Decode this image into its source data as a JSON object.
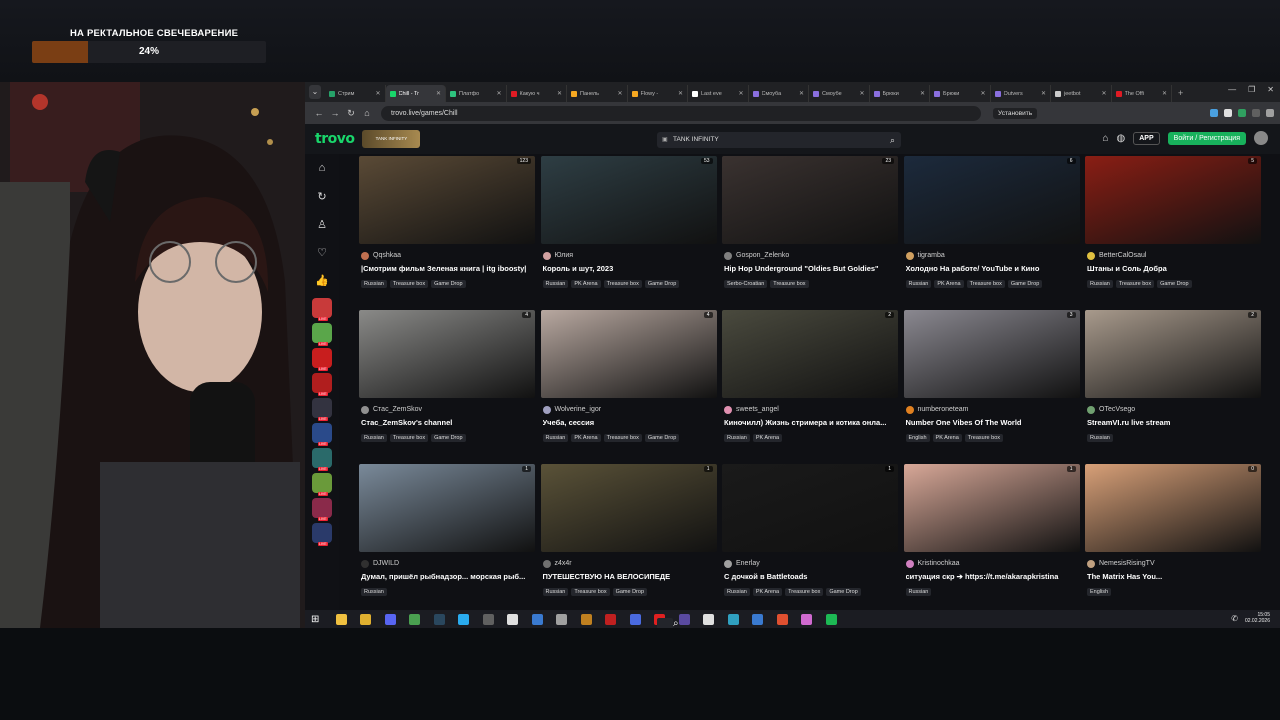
{
  "overlay": {
    "goal_label": "НА РЕКТАЛЬНОЕ СВЕЧЕВАРЕНИЕ",
    "goal_percent_text": "24%",
    "goal_progress": 0.24,
    "goal_color": "#7a3e14"
  },
  "browser": {
    "tabs": [
      {
        "label": "Стрим",
        "color": "#26a269"
      },
      {
        "label": "Chill - Tr",
        "color": "#19d66b",
        "active": true
      },
      {
        "label": "Платфо",
        "color": "#2ec27e"
      },
      {
        "label": "Какую ч",
        "color": "#e01b24"
      },
      {
        "label": "Панель",
        "color": "#f6a821"
      },
      {
        "label": "Flowy -",
        "color": "#f6a821"
      },
      {
        "label": "Last eve",
        "color": "#ffffff"
      },
      {
        "label": "Смоуба",
        "color": "#8a6fdf"
      },
      {
        "label": "Смоубе",
        "color": "#8a6fdf"
      },
      {
        "label": "Брюки",
        "color": "#8a6fdf"
      },
      {
        "label": "Брюки",
        "color": "#8a6fdf"
      },
      {
        "label": "Outvers",
        "color": "#8a6fdf"
      },
      {
        "label": "jeetbot",
        "color": "#cccccc"
      },
      {
        "label": "The Offi",
        "color": "#e01b24"
      }
    ],
    "url": "trovo.live/games/Chill",
    "install_label": "Установить"
  },
  "trovo": {
    "logo": "trovo",
    "promo_text": "TANK INFINITY",
    "search_value": "TANK INFINITY",
    "app_label": "APP",
    "login_label": "Войти / Регистрация",
    "brand_color": "#19d66b"
  },
  "rail": {
    "nav_icons": [
      "home-icon",
      "following-icon",
      "profile-icon",
      "heart-icon",
      "thumbs-up-icon"
    ],
    "channels": [
      {
        "color": "#c83a3a"
      },
      {
        "color": "#5aa64a"
      },
      {
        "color": "#c81e1e"
      },
      {
        "color": "#b01e1e"
      },
      {
        "color": "#333340"
      },
      {
        "color": "#2a4a8a"
      },
      {
        "color": "#2a6a6a"
      },
      {
        "color": "#6a9a3a"
      },
      {
        "color": "#8a2a4a"
      },
      {
        "color": "#2a3a6a"
      }
    ],
    "live_label": "LIVE"
  },
  "streams": [
    {
      "viewers": "123",
      "user": "Qqshkaa",
      "title": "|Смотрим фильм Зеленая книга | itg iboosty|",
      "tags": [
        "Russian",
        "Treasure box",
        "Game Drop"
      ],
      "bg": "#5a4a36",
      "av": "#c07050"
    },
    {
      "viewers": "53",
      "user": "Юлия",
      "title": "Король и шут, 2023",
      "tags": [
        "Russian",
        "PK Arena",
        "Treasure box",
        "Game Drop"
      ],
      "bg": "#2e3e44",
      "av": "#d0a0a0"
    },
    {
      "viewers": "23",
      "user": "Gospon_Zelenko",
      "title": "Hip Hop Underground \"Oldies But Goldies\"",
      "tags": [
        "Serbo-Croatian",
        "Treasure box"
      ],
      "bg": "#3a3230",
      "av": "#808080"
    },
    {
      "viewers": "6",
      "user": "tigramba",
      "title": "Холодно На работе/ YouTube и Кино",
      "tags": [
        "Russian",
        "PK Arena",
        "Treasure box",
        "Game Drop"
      ],
      "bg": "#1c2a3c",
      "av": "#d0a060"
    },
    {
      "viewers": "5",
      "user": "BetterCalOsaul",
      "title": "Штаны и Соль Добра",
      "tags": [
        "Russian",
        "Treasure box",
        "Game Drop"
      ],
      "bg": "#8a1e14",
      "av": "#e0c040"
    },
    {
      "viewers": "4",
      "user": "Стас_ZemSkov",
      "title": "Стас_ZemSkov's channel",
      "tags": [
        "Russian",
        "Treasure box",
        "Game Drop"
      ],
      "bg": "#8a8a88",
      "av": "#909090"
    },
    {
      "viewers": "4",
      "user": "Wolverine_igor",
      "title": "Учеба, сессия",
      "tags": [
        "Russian",
        "PK Arena",
        "Treasure box",
        "Game Drop"
      ],
      "bg": "#b8a8a0",
      "av": "#a0a0c0"
    },
    {
      "viewers": "2",
      "user": "sweets_angel",
      "title": "Киночилл) Жизнь стримера и котика онла...",
      "tags": [
        "Russian",
        "PK Arena"
      ],
      "bg": "#4a4a3e",
      "av": "#e090b0"
    },
    {
      "viewers": "3",
      "user": "numberoneteam",
      "title": "Number One Vibes Of The World",
      "tags": [
        "English",
        "PK Arena",
        "Treasure box"
      ],
      "bg": "#8a8890",
      "av": "#e08020"
    },
    {
      "viewers": "2",
      "user": "OTecVsego",
      "title": "StreamVI.ru live stream",
      "tags": [
        "Russian"
      ],
      "bg": "#a89a8c",
      "av": "#70a070"
    },
    {
      "viewers": "1",
      "user": "DJWILD",
      "title": "Думал, пришёл рыбнадзор... морская рыб...",
      "tags": [
        "Russian"
      ],
      "bg": "#7a8a9a",
      "av": "#303030"
    },
    {
      "viewers": "1",
      "user": "z4x4r",
      "title": "ПУТЕШЕСТВУЮ НА ВЕЛОСИПЕДЕ",
      "tags": [
        "Russian",
        "Treasure box",
        "Game Drop"
      ],
      "bg": "#5a5238",
      "av": "#707070"
    },
    {
      "viewers": "1",
      "user": "Enerlay",
      "title": "С дочкой в Battletoads",
      "tags": [
        "Russian",
        "PK Arena",
        "Treasure box",
        "Game Drop"
      ],
      "bg": "#1a1a1a",
      "av": "#a0a0a0"
    },
    {
      "viewers": "1",
      "user": "Kristinochkaa",
      "title": "ситуация скр ➔ https://t.me/akarapkristina",
      "tags": [
        "Russian"
      ],
      "bg": "#d8a898",
      "av": "#d080c0"
    },
    {
      "viewers": "0",
      "user": "NemesisRisingTV",
      "title": "The Matrix Has You...",
      "tags": [
        "English"
      ],
      "bg": "#d8a078",
      "av": "#c0a080"
    }
  ],
  "taskbar": {
    "time": "15:05",
    "date": "02.02.2026",
    "icons": [
      {
        "name": "explorer-icon",
        "color": "#f0c040"
      },
      {
        "name": "folder-icon",
        "color": "#e0b030"
      },
      {
        "name": "discord-icon",
        "color": "#5865f2"
      },
      {
        "name": "chrome-icon",
        "color": "#4aa050"
      },
      {
        "name": "steam-icon",
        "color": "#2a475e"
      },
      {
        "name": "telegram-icon",
        "color": "#2aabee"
      },
      {
        "name": "obs-icon",
        "color": "#606060"
      },
      {
        "name": "file-icon",
        "color": "#e0e0e0"
      },
      {
        "name": "lc-icon",
        "color": "#3a7ad0"
      },
      {
        "name": "cloud-icon",
        "color": "#a0a0a0"
      },
      {
        "name": "app-icon",
        "color": "#c08020"
      },
      {
        "name": "app2-icon",
        "color": "#c02020"
      },
      {
        "name": "t-icon",
        "color": "#4a6ae0"
      },
      {
        "name": "yandex-icon",
        "color": "#e02020"
      },
      {
        "name": "app3-icon",
        "color": "#5a4aa0"
      },
      {
        "name": "doc-icon",
        "color": "#e0e0e0"
      },
      {
        "name": "c-icon",
        "color": "#30a0c0"
      },
      {
        "name": "chart-icon",
        "color": "#3a7ad0"
      },
      {
        "name": "app4-icon",
        "color": "#e05030"
      },
      {
        "name": "app5-icon",
        "color": "#d06ad0"
      },
      {
        "name": "spotify-icon",
        "color": "#1db954"
      }
    ]
  }
}
